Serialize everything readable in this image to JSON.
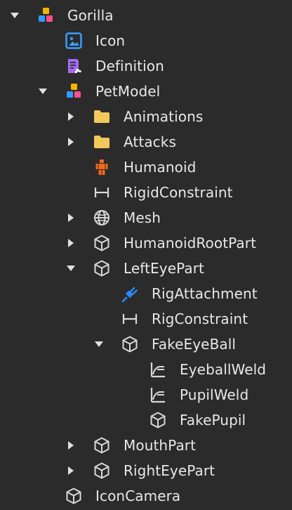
{
  "tree": {
    "items": [
      {
        "label": "Gorilla",
        "depth": 0,
        "toggle": "expanded",
        "icon": "model-icon"
      },
      {
        "label": "Icon",
        "depth": 1,
        "toggle": "none",
        "icon": "image-icon"
      },
      {
        "label": "Definition",
        "depth": 1,
        "toggle": "none",
        "icon": "module-script-icon"
      },
      {
        "label": "PetModel",
        "depth": 1,
        "toggle": "expanded",
        "icon": "model-icon"
      },
      {
        "label": "Animations",
        "depth": 2,
        "toggle": "collapsed",
        "icon": "folder-icon"
      },
      {
        "label": "Attacks",
        "depth": 2,
        "toggle": "collapsed",
        "icon": "folder-icon"
      },
      {
        "label": "Humanoid",
        "depth": 2,
        "toggle": "none",
        "icon": "humanoid-icon"
      },
      {
        "label": "RigidConstraint",
        "depth": 2,
        "toggle": "none",
        "icon": "constraint-icon"
      },
      {
        "label": "Mesh",
        "depth": 2,
        "toggle": "collapsed",
        "icon": "mesh-icon"
      },
      {
        "label": "HumanoidRootPart",
        "depth": 2,
        "toggle": "collapsed",
        "icon": "part-icon"
      },
      {
        "label": "LeftEyePart",
        "depth": 2,
        "toggle": "expanded",
        "icon": "part-icon"
      },
      {
        "label": "RigAttachment",
        "depth": 3,
        "toggle": "none",
        "icon": "attachment-icon"
      },
      {
        "label": "RigConstraint",
        "depth": 3,
        "toggle": "none",
        "icon": "constraint-icon"
      },
      {
        "label": "FakeEyeBall",
        "depth": 3,
        "toggle": "expanded",
        "icon": "part-icon"
      },
      {
        "label": "EyeballWeld",
        "depth": 4,
        "toggle": "none",
        "icon": "weld-icon"
      },
      {
        "label": "PupilWeld",
        "depth": 4,
        "toggle": "none",
        "icon": "weld-icon"
      },
      {
        "label": "FakePupil",
        "depth": 4,
        "toggle": "none",
        "icon": "part-icon"
      },
      {
        "label": "MouthPart",
        "depth": 2,
        "toggle": "collapsed",
        "icon": "part-icon"
      },
      {
        "label": "RightEyePart",
        "depth": 2,
        "toggle": "collapsed",
        "icon": "part-icon"
      },
      {
        "label": "IconCamera",
        "depth": 1,
        "toggle": "none",
        "icon": "part-icon"
      }
    ]
  },
  "colors": {
    "background": "#2b2b2b",
    "text": "#e8e8e8",
    "icon_gray": "#d8d8d8",
    "model_yellow": "#f5b400",
    "model_blue": "#2f9bff",
    "model_pink": "#ff4d8d",
    "image_blue": "#3aa0ff",
    "script_purple": "#a36cf2",
    "folder_yellow": "#f2c75c",
    "humanoid_orange": "#f26a1b",
    "attachment_blue": "#2a8cff"
  }
}
